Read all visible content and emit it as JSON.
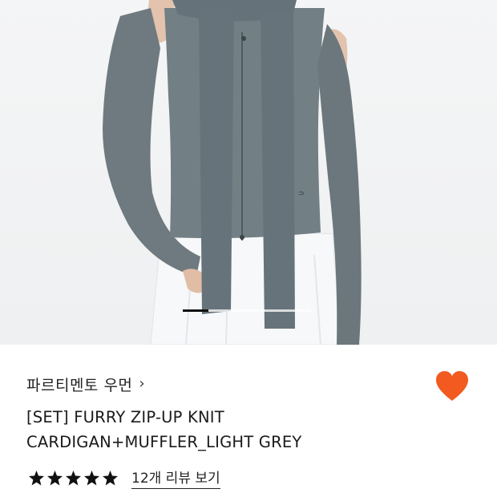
{
  "product": {
    "image_alt": "",
    "carousel_progress": 0.2
  },
  "brand": {
    "name": "파르티멘토 우먼",
    "chevron": "›"
  },
  "title": {
    "line1": "[SET] FURRY ZIP-UP KNIT",
    "line2": "CARDIGAN+MUFFLER_LIGHT GREY"
  },
  "rating": {
    "stars": 5,
    "review_link": "12개 리뷰 보기"
  },
  "icons": {
    "wishlist": "heart-icon",
    "star": "star-icon",
    "chevron": "chevron-right-icon"
  },
  "colors": {
    "wishlist": "#f25a1f",
    "knit": "#6e7a7f",
    "skirt": "#f7f8fa"
  }
}
